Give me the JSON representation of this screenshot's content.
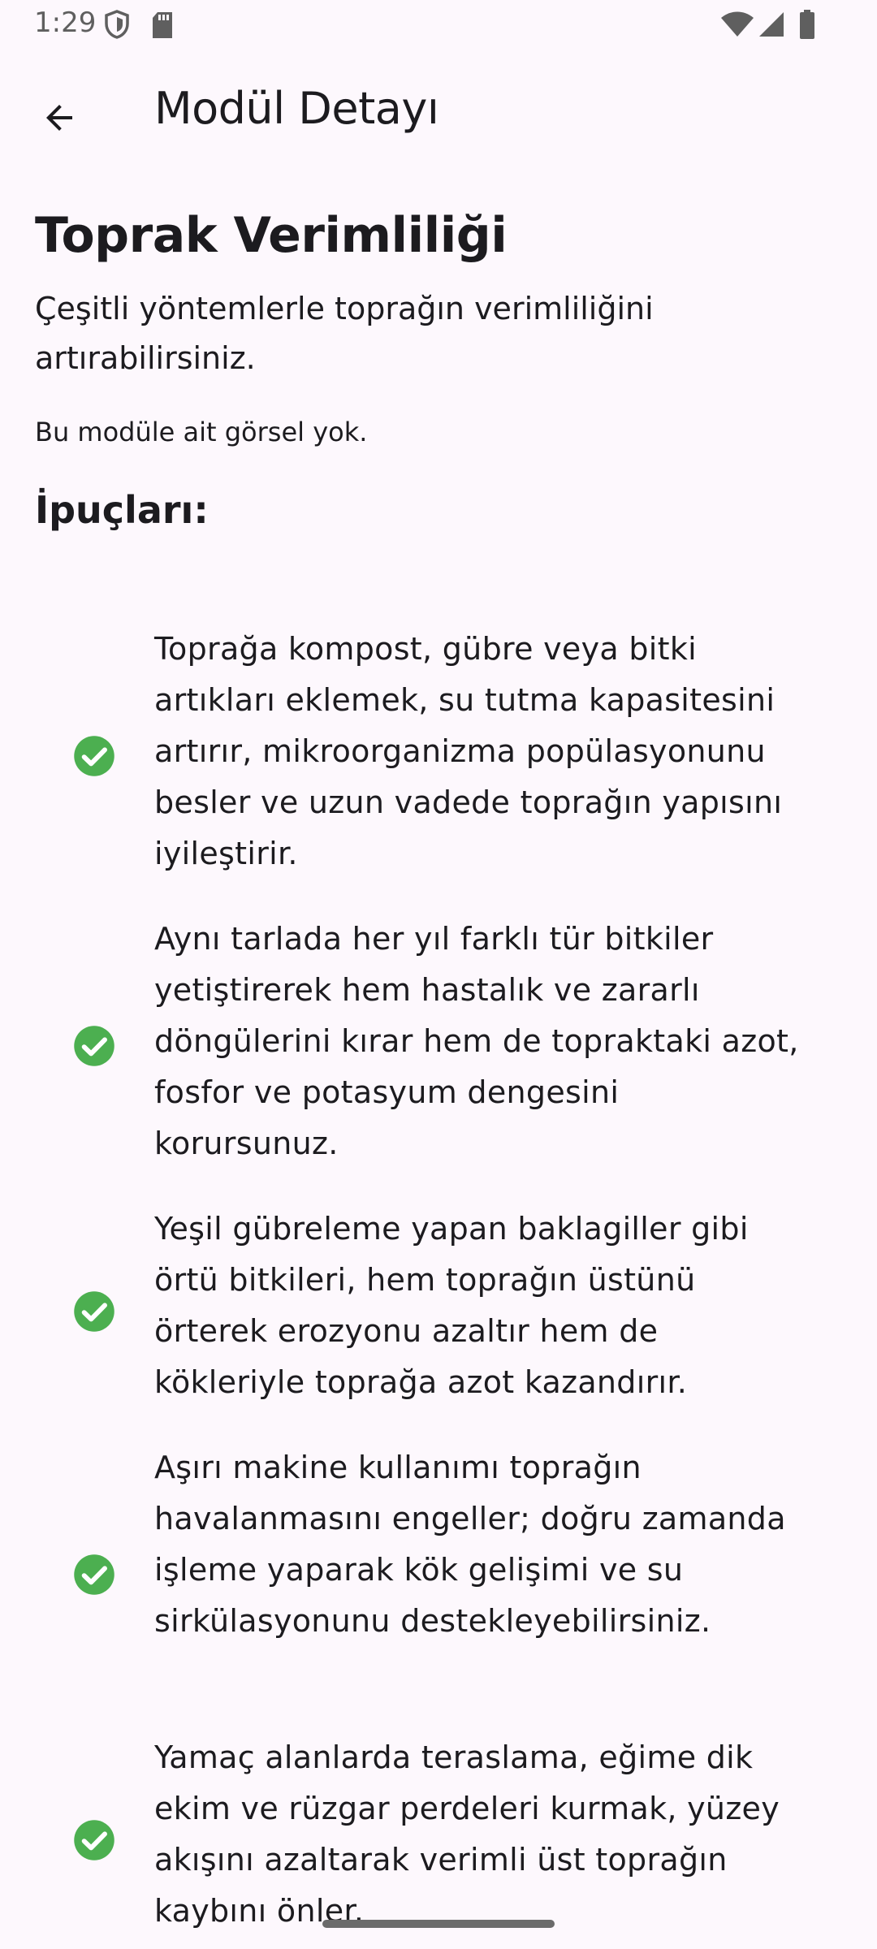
{
  "status_bar": {
    "time": "1:29",
    "icons": [
      "shield-icon",
      "sd-card-icon",
      "wifi-icon",
      "signal-icon",
      "battery-icon"
    ]
  },
  "app_bar": {
    "title": "Modül Detayı",
    "back_icon": "arrow-back-icon"
  },
  "module": {
    "title": "Toprak Verimliliği",
    "description": "Çeşitli yöntemlerle toprağın verimliliğini artırabilirsiniz.",
    "no_image_text": "Bu modüle ait görsel yok.",
    "tips_heading": "İpuçları:"
  },
  "tips": [
    {
      "icon": "check-circle-icon",
      "text": "Toprağa kompost, gübre veya bitki artıkları eklemek, su tutma kapasitesini artırır, mikroorganizma popülasyonunu besler ve uzun vadede toprağın yapısını iyileştirir."
    },
    {
      "icon": "check-circle-icon",
      "text": "Aynı tarlada her yıl farklı tür bitkiler yetiştirerek hem hastalık ve zararlı döngülerini kırar hem de topraktaki azot, fosfor ve potasyum dengesini korursunuz."
    },
    {
      "icon": "check-circle-icon",
      "text": "Yeşil gübreleme yapan baklagiller gibi örtü bitkileri, hem toprağın üstünü örterek erozyonu azaltır hem de kökleriyle toprağa azot kazandırır."
    },
    {
      "icon": "check-circle-icon",
      "text": "Aşırı makine kullanımı toprağın havalanmasını engeller; doğru zamanda işleme yaparak kök gelişimi ve su sirkülasyonunu destekleyebilirsiniz."
    },
    {
      "icon": "check-circle-icon",
      "text": "Yamaç alanlarda teraslama, eğime dik ekim ve rüzgar perdeleri kurmak, yüzey akışını azaltarak verimli üst toprağın kaybını önler."
    }
  ],
  "colors": {
    "background": "#fdf8fd",
    "text": "#1c1b1f",
    "check": "#4caf50"
  }
}
